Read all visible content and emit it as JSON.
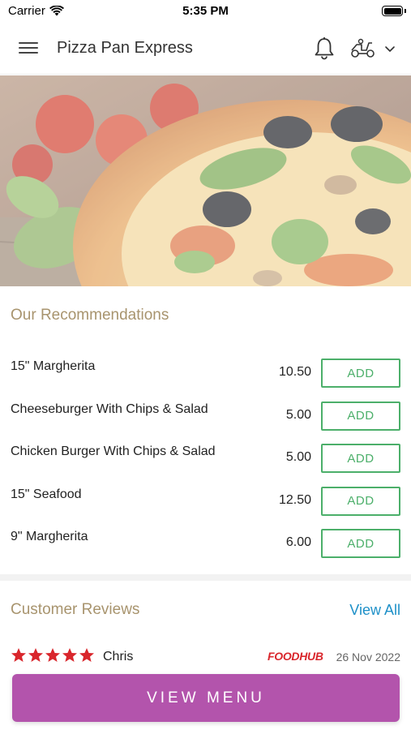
{
  "status_bar": {
    "carrier": "Carrier",
    "time": "5:35 PM",
    "wifi_icon": "wifi-icon",
    "battery_icon": "battery-icon"
  },
  "header": {
    "title": "Pizza Pan Express",
    "menu_icon": "hamburger-menu-icon",
    "notification_icon": "bell-icon",
    "delivery_icon": "scooter-icon",
    "dropdown_icon": "chevron-down-icon"
  },
  "hero": {
    "image": "pizza-hero-image"
  },
  "recommendations": {
    "title": "Our Recommendations",
    "add_label": "ADD",
    "items": [
      {
        "name": "15\" Margherita",
        "price": "10.50"
      },
      {
        "name": "Cheeseburger With Chips & Salad",
        "price": "5.00"
      },
      {
        "name": "Chicken Burger With Chips & Salad",
        "price": "5.00"
      },
      {
        "name": "15\" Seafood",
        "price": "12.50"
      },
      {
        "name": "9\" Margherita",
        "price": "6.00"
      }
    ]
  },
  "reviews": {
    "title": "Customer Reviews",
    "view_all": "View All",
    "items": [
      {
        "reviewer": "Chris",
        "rating": 5,
        "source": "FOODHUB",
        "date": "26 Nov 2022"
      }
    ]
  },
  "cta": {
    "label": "VIEW MENU"
  },
  "colors": {
    "accent_purple": "#b354ac",
    "add_green": "#4caf6a",
    "section_title": "#a8946e",
    "link_blue": "#1e90c8",
    "star_red": "#d9262c"
  }
}
